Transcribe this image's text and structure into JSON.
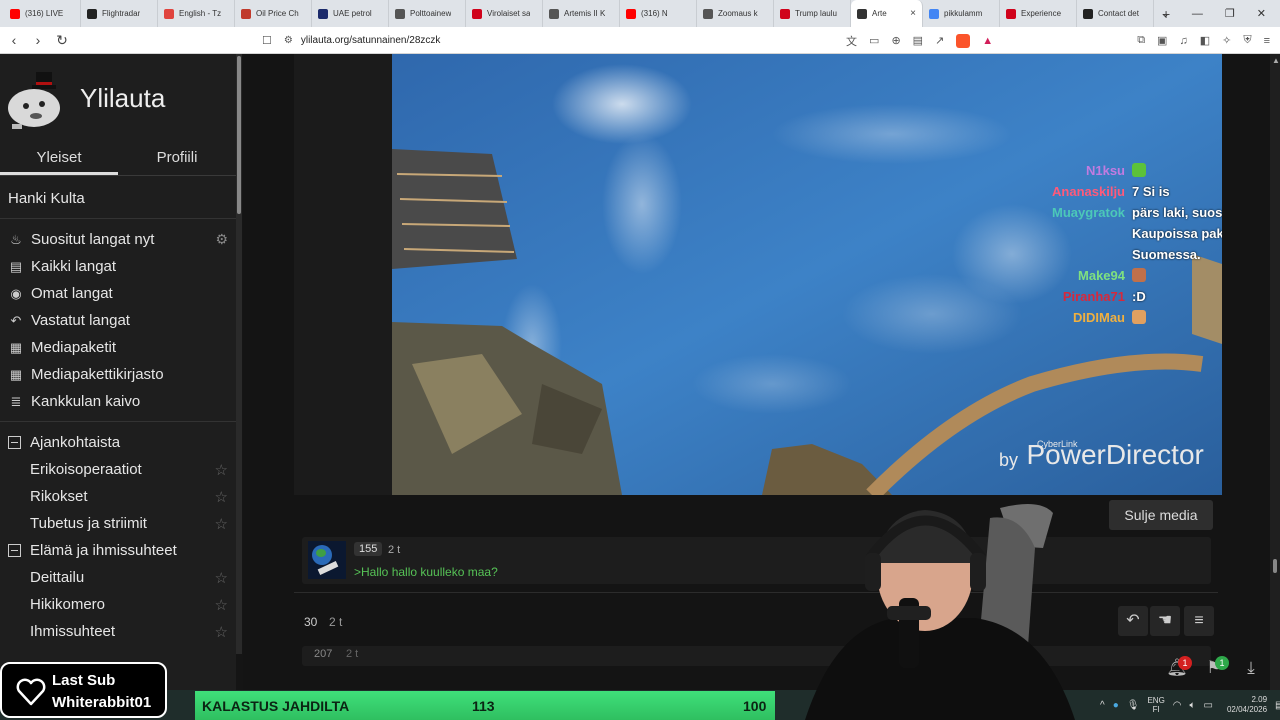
{
  "browser": {
    "tabs": [
      {
        "title": "(316) LIVE",
        "icon": "youtube-icon",
        "color": "#ff0000"
      },
      {
        "title": "Flightradar",
        "icon": "flightradar-icon",
        "color": "#222222"
      },
      {
        "title": "English - Tz",
        "icon": "translate-icon",
        "color": "#e0443e"
      },
      {
        "title": "Oil Price Ch",
        "icon": "oilprice-icon",
        "color": "#c0392b"
      },
      {
        "title": "UAE petrol",
        "icon": "news-icon",
        "color": "#1b2a6b"
      },
      {
        "title": "Polttoainew",
        "icon": "globe-icon",
        "color": "#555555"
      },
      {
        "title": "Virolaiset sa",
        "icon": "il-icon",
        "color": "#d0021b"
      },
      {
        "title": "Artemis II K",
        "icon": "globe-icon",
        "color": "#555555"
      },
      {
        "title": "(316) N",
        "icon": "youtube-icon",
        "color": "#ff0000"
      },
      {
        "title": "Zoomaus k",
        "icon": "globe-icon",
        "color": "#555555"
      },
      {
        "title": "Trump laulu",
        "icon": "il-icon",
        "color": "#d0021b"
      },
      {
        "title": "Arte",
        "icon": "ylilauta-icon",
        "color": "#333333",
        "active": true
      },
      {
        "title": "pikkulamm",
        "icon": "google-icon",
        "color": "#4285f4"
      },
      {
        "title": "Experience",
        "icon": "experience-icon",
        "color": "#d0021b"
      },
      {
        "title": "Contact det",
        "icon": "contact-icon",
        "color": "#222222"
      }
    ],
    "close_tab": "×",
    "new_tab": "+",
    "url": "ylilauta.org/satunnainen/28zczk"
  },
  "sidebar": {
    "brand": "Ylilauta",
    "tabs": [
      "Yleiset",
      "Profiili"
    ],
    "hanki": "Hanki Kulta",
    "nav": [
      {
        "label": "Suositut langat nyt",
        "icon": "fire-icon",
        "glyph": "♨",
        "gear": true
      },
      {
        "label": "Kaikki langat",
        "icon": "list-icon",
        "glyph": "▤"
      },
      {
        "label": "Omat langat",
        "icon": "user-threads-icon",
        "glyph": "◉"
      },
      {
        "label": "Vastatut langat",
        "icon": "reply-icon",
        "glyph": "↶"
      },
      {
        "label": "Mediapaketit",
        "icon": "media-package-icon",
        "glyph": "▦"
      },
      {
        "label": "Mediapakettikirjasto",
        "icon": "media-library-icon",
        "glyph": "▦"
      },
      {
        "label": "Kankkulan kaivo",
        "icon": "well-icon",
        "glyph": "≣"
      }
    ],
    "groups": [
      {
        "label": "Ajankohtaista",
        "items": [
          "Erikoisoperaatiot",
          "Rikokset",
          "Tubetus ja striimit"
        ]
      },
      {
        "label": "Elämä ja ihmissuhteet",
        "items": [
          "Deittailu",
          "Hikikomero",
          "Ihmissuhteet"
        ]
      }
    ]
  },
  "video": {
    "chat": [
      {
        "name": "N1ksu",
        "color": "#c27be0",
        "msg": "",
        "emote": "check-emote"
      },
      {
        "name": "Ananaskilju",
        "color": "#ff5a7a",
        "msg": "7 Si is"
      },
      {
        "name": "Muaygratok",
        "color": "#4cc8b8",
        "msg": "pärs laki, suosittelen. myydään ainakin K-Kaupoissa pakattuna tiskillä Varsinais-Suomessa."
      },
      {
        "name": "Make94",
        "color": "#7fe07f",
        "msg": "",
        "emote": "face-emote"
      },
      {
        "name": "Piranha71",
        "color": "#d8283b",
        "msg": ":D"
      },
      {
        "name": "DIDIMau",
        "color": "#f0b040",
        "msg": "",
        "emote": "cat-emote"
      }
    ],
    "watermark_by": "by",
    "watermark_brand": "CyberLink",
    "watermark_product": "PowerDirector"
  },
  "close_media": "Sulje media",
  "post": {
    "number": "155",
    "time": "2 t",
    "text": ">Hallo hallo kuulleko maa?"
  },
  "thread": {
    "count": "30",
    "time": "2 t"
  },
  "next_post": {
    "number": "207",
    "time": "2 t"
  },
  "notifications": {
    "bell_count": "1",
    "bookmark_count": "1"
  },
  "overlay": {
    "last_sub_title": "Last Sub",
    "last_sub_name": "Whiterabbit01",
    "ticker_label": "KALASTUS JAHDILTA",
    "ticker_value1": "113",
    "ticker_value2": "100"
  },
  "tray": {
    "lang_top": "ENG",
    "lang_bottom": "FI",
    "time": "2.09",
    "date": "02/04/2026"
  }
}
